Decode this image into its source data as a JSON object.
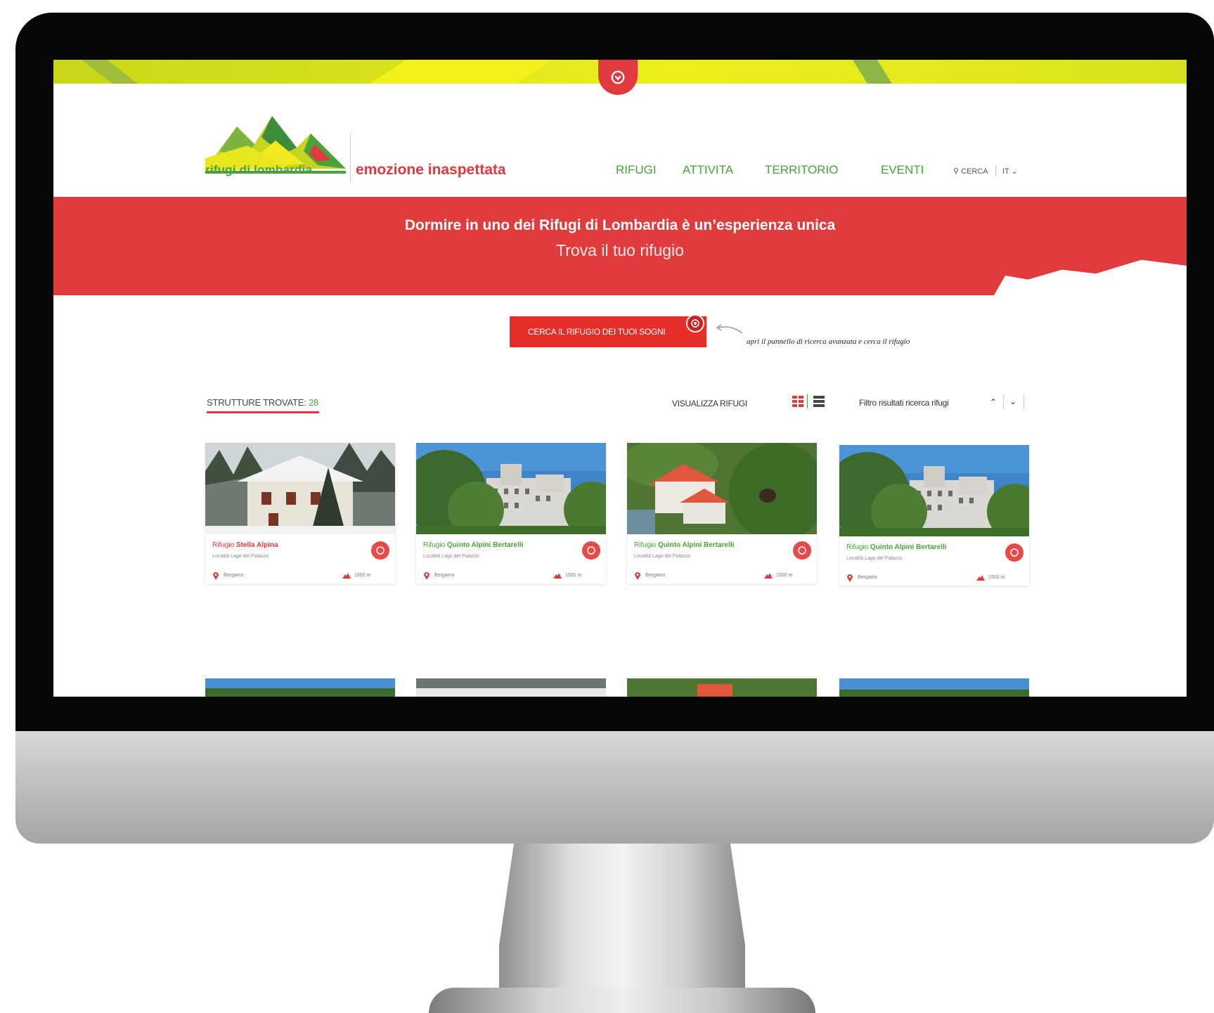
{
  "brand": {
    "logo_text_part1": "rifugi",
    "logo_text_part2": "di lombardia",
    "tagline": "emozione inaspettata",
    "colors": {
      "red": "#e03a3e",
      "green": "#4aa23c",
      "yellow": "#e6ec1f"
    }
  },
  "nav": {
    "items": [
      "RIFUGI",
      "ATTIVITA",
      "TERRITORIO",
      "EVENTI"
    ],
    "search_label": "CERCA",
    "language": "IT"
  },
  "hero": {
    "title": "Dormire in uno dei Rifugi di Lombardia è un’esperienza unica",
    "subtitle": "Trova il tuo rifugio"
  },
  "cta": {
    "button_label": "CERCA IL RIFUGIO DEI TUOI SOGNI",
    "hint": "apri il pannello di ricerca avanzata e cerca il rifugio"
  },
  "results": {
    "found_label": "STRUTTURE TROVATE:",
    "found_count": "28",
    "view_label": "VISUALIZZA RIFUGI",
    "filter_label": "Filtro risultati ricerca rifugi"
  },
  "cards": [
    {
      "name_prefix": "Rifugio",
      "name": "Stella Alpina",
      "locality": "Località Lago del Palazzo",
      "province": "Bergamo",
      "altitude": "1500 m",
      "photo": "snow"
    },
    {
      "name_prefix": "Rifugio",
      "name": "Quinto Alpini Bertarelli",
      "locality": "Località Lago del Palazzo",
      "province": "Bergamo",
      "altitude": "1500 m",
      "photo": "building"
    },
    {
      "name_prefix": "Rifugio",
      "name": "Quinto Alpini Bertarelli",
      "locality": "Località Lago del Palazzo",
      "province": "Bergamo",
      "altitude": "1500 m",
      "photo": "redroof"
    },
    {
      "name_prefix": "Rifugio",
      "name": "Quinto Alpini Bertarelli",
      "locality": "Località Lago del Palazzo",
      "province": "Bergamo",
      "altitude": "1500 m",
      "photo": "building"
    }
  ]
}
